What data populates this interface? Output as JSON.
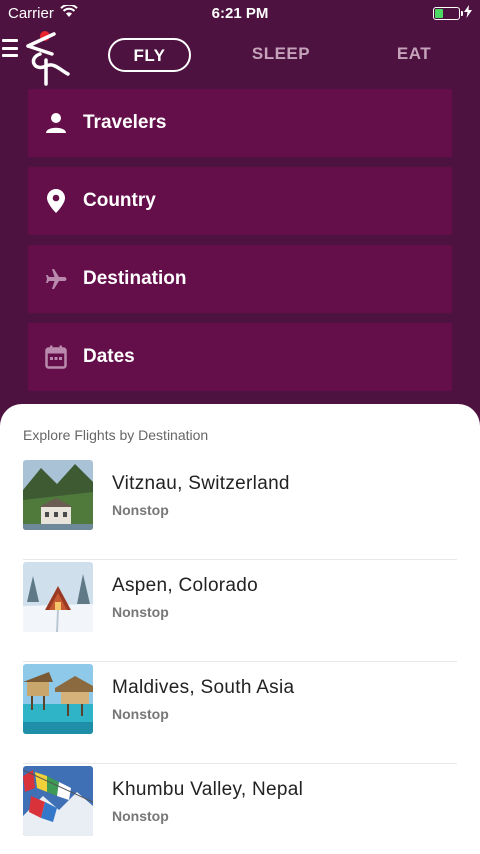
{
  "status_bar": {
    "carrier": "Carrier",
    "time": "6:21 PM"
  },
  "nav": {
    "tabs": [
      {
        "label": "FLY",
        "active": true
      },
      {
        "label": "SLEEP",
        "active": false
      },
      {
        "label": "EAT",
        "active": false
      }
    ]
  },
  "fields": [
    {
      "label": "Travelers",
      "icon": "person-icon"
    },
    {
      "label": "Country",
      "icon": "location-pin-icon"
    },
    {
      "label": "Destination",
      "icon": "airplane-icon"
    },
    {
      "label": "Dates",
      "icon": "calendar-icon"
    }
  ],
  "explore": {
    "title": "Explore Flights by Destination",
    "destinations": [
      {
        "name": "Vitznau, Switzerland",
        "subtitle": "Nonstop"
      },
      {
        "name": "Aspen, Colorado",
        "subtitle": "Nonstop"
      },
      {
        "name": "Maldives, South Asia",
        "subtitle": "Nonstop"
      },
      {
        "name": "Khumbu Valley, Nepal",
        "subtitle": "Nonstop"
      }
    ]
  },
  "colors": {
    "background": "#4d1240",
    "field_background": "#640e4a",
    "logo_dot": "#e8262e",
    "battery": "#4cd964"
  }
}
